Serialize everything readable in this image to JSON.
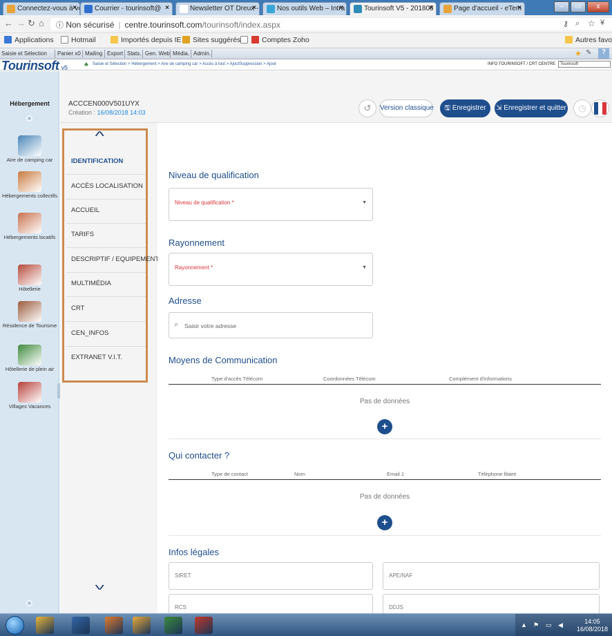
{
  "browser": {
    "tabs": [
      {
        "title": "Connectez-vous à votr",
        "color": "#e8a33a",
        "active": false
      },
      {
        "title": "Courrier - tourinsoft@",
        "color": "#2f6fce",
        "active": false
      },
      {
        "title": "Newsletter OT Dreux -",
        "color": "#ffffff",
        "active": false
      },
      {
        "title": "Nos outils Web – Intra",
        "color": "#3aa6d8",
        "active": false
      },
      {
        "title": "Tourinsoft V5 - 201808",
        "color": "#2f8bb8",
        "active": true
      },
      {
        "title": "Page d'accueil - eTem",
        "color": "#e8a33a",
        "active": false
      }
    ],
    "window_buttons": [
      "–",
      "▭",
      "x"
    ],
    "url_secure": "Non sécurisé",
    "url_host": "centre.tourinsoft.com",
    "url_path": "/tourinsoft/index.aspx",
    "bookmarks": [
      "Applications",
      "Hotmail",
      "Importés depuis IE",
      "Sites suggérés",
      "Comptes Zoho",
      "Autres favoris"
    ]
  },
  "app_menu": [
    "Saisie et Sélection",
    "Panier x0",
    "Mailing",
    "Export",
    "Stats.",
    "Gen. Web",
    "Média.",
    "Admin."
  ],
  "brand": {
    "logo": "Tourinsoft",
    "version": "v5",
    "breadcrumb": "Saisie et Sélection > Hébergement > Aire de camping car > Accès à tout > AjoutSuppression > Ajout",
    "info": "INFO TOURINSOFT / CRT CENTRE",
    "user": "Tourinsoft"
  },
  "left_panel": {
    "title": "Hébergement",
    "items": [
      {
        "label": "Aire de camping car",
        "color": "#4a86b8"
      },
      {
        "label": "Hébergements collectifs",
        "color": "#c97a3e"
      },
      {
        "label": "Hébergements locatifs",
        "color": "#c9714f"
      },
      {
        "label": "Hôtellerie",
        "color": "#b64a3a"
      },
      {
        "label": "Résidence de Tourisme",
        "color": "#9a5a3c"
      },
      {
        "label": "Hôtellerie de plein air",
        "color": "#3f8a3c"
      },
      {
        "label": "Villages Vacances",
        "color": "#b8403a"
      }
    ]
  },
  "record": {
    "code": "ACCCEN000V501UYX",
    "created_prefix": "Création :",
    "created_date": "16/08/2018 14:03"
  },
  "toolbar": {
    "classic": "Version classique",
    "save": "Enregistrer",
    "save_quit": "Enregistrer et quitter"
  },
  "sections_nav": [
    "IDENTIFICATION",
    "ACCÈS LOCALISATION",
    "ACCUEIL",
    "TARIFS",
    "DESCRIPTIF / EQUIPEMENTS",
    "MULTIMÉDIA",
    "CRT",
    "CEN_INFOS",
    "EXTRANET V.I.T."
  ],
  "form": {
    "qualification_title": "Niveau de qualification",
    "qualification_label": "Niveau de qualification *",
    "rayonnement_title": "Rayonnement",
    "rayonnement_label": "Rayonnement *",
    "adresse_title": "Adresse",
    "adresse_placeholder": "Saisir votre adresse",
    "communication_title": "Moyens de Communication",
    "communication_cols": [
      "Type d'accès Télécom",
      "Coordonnées Télécom",
      "Complément d'informations"
    ],
    "no_data": "Pas de données",
    "contact_title": "Qui contacter ?",
    "contact_cols": [
      "Type de contact",
      "Nom",
      "Email 1",
      "Téléphone filaire"
    ],
    "legal_title": "Infos légales",
    "legal_fields": [
      "SIRET",
      "APE/NAF",
      "RCS",
      "DDJS"
    ]
  },
  "taskbar": {
    "time": "14:05",
    "date": "16/08/2018",
    "apps": [
      "#e8b33a",
      "#3465a4",
      "#e07a2e",
      "#e8a93a",
      "#3d8a3d",
      "#c0392b"
    ]
  }
}
